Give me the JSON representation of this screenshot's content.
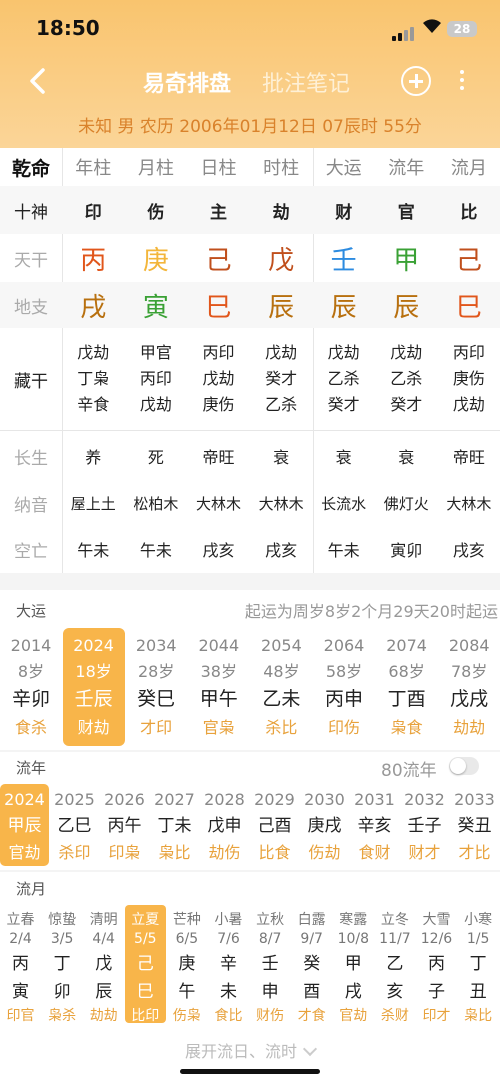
{
  "status": {
    "time": "18:50",
    "battery": "28"
  },
  "nav": {
    "title": "易奇排盘",
    "title2": "批注笔记"
  },
  "info": "未知 男 农历 2006年01月12日 07辰时 55分",
  "table": {
    "header": [
      "乾命",
      "年柱",
      "月柱",
      "日柱",
      "时柱",
      "大运",
      "流年",
      "流月"
    ],
    "shishen": {
      "label": "十神",
      "values": [
        "印",
        "伤",
        "主",
        "劫",
        "财",
        "官",
        "比"
      ]
    },
    "tiangan": {
      "label": "天干",
      "values": [
        "丙",
        "庚",
        "己",
        "戊",
        "壬",
        "甲",
        "己"
      ],
      "colors": [
        "#e1561b",
        "#f3b63b",
        "#c04f1c",
        "#c04f1c",
        "#2c8be0",
        "#3aa135",
        "#c04f1c"
      ]
    },
    "dizhi": {
      "label": "地支",
      "values": [
        "戌",
        "寅",
        "巳",
        "辰",
        "辰",
        "辰",
        "巳"
      ],
      "colors": [
        "#b8700f",
        "#3aa135",
        "#e1561b",
        "#b8700f",
        "#b8700f",
        "#b8700f",
        "#e1561b"
      ]
    },
    "canggan": {
      "label": "藏干",
      "values": [
        [
          "戊劫",
          "丁枭",
          "辛食"
        ],
        [
          "甲官",
          "丙印",
          "戊劫"
        ],
        [
          "丙印",
          "戊劫",
          "庚伤"
        ],
        [
          "戊劫",
          "癸才",
          "乙杀"
        ],
        [
          "戊劫",
          "乙杀",
          "癸才"
        ],
        [
          "戊劫",
          "乙杀",
          "癸才"
        ],
        [
          "丙印",
          "庚伤",
          "戊劫"
        ]
      ]
    },
    "changsheng": {
      "label": "长生",
      "values": [
        "养",
        "死",
        "帝旺",
        "衰",
        "衰",
        "衰",
        "帝旺"
      ]
    },
    "nayin": {
      "label": "纳音",
      "values": [
        "屋上土",
        "松柏木",
        "大林木",
        "大林木",
        "长流水",
        "佛灯火",
        "大林木"
      ]
    },
    "kongwang": {
      "label": "空亡",
      "values": [
        "午未",
        "午未",
        "戌亥",
        "戌亥",
        "午未",
        "寅卯",
        "戌亥"
      ]
    }
  },
  "dayun": {
    "title": "大运",
    "note": "起运为周岁8岁2个月29天20时起运",
    "items": [
      {
        "year": "2014",
        "age": "8岁",
        "gz": "辛卯",
        "ss": "食杀"
      },
      {
        "year": "2024",
        "age": "18岁",
        "gz": "壬辰",
        "ss": "财劫",
        "active": true
      },
      {
        "year": "2034",
        "age": "28岁",
        "gz": "癸巳",
        "ss": "才印"
      },
      {
        "year": "2044",
        "age": "38岁",
        "gz": "甲午",
        "ss": "官枭"
      },
      {
        "year": "2054",
        "age": "48岁",
        "gz": "乙未",
        "ss": "杀比"
      },
      {
        "year": "2064",
        "age": "58岁",
        "gz": "丙申",
        "ss": "印伤"
      },
      {
        "year": "2074",
        "age": "68岁",
        "gz": "丁酉",
        "ss": "枭食"
      },
      {
        "year": "2084",
        "age": "78岁",
        "gz": "戊戌",
        "ss": "劫劫"
      }
    ]
  },
  "liunian": {
    "title": "流年",
    "toggle_label": "80流年",
    "items": [
      {
        "year": "2024",
        "gz": "甲辰",
        "ss": "官劫",
        "active": true
      },
      {
        "year": "2025",
        "gz": "乙巳",
        "ss": "杀印"
      },
      {
        "year": "2026",
        "gz": "丙午",
        "ss": "印枭"
      },
      {
        "year": "2027",
        "gz": "丁未",
        "ss": "枭比"
      },
      {
        "year": "2028",
        "gz": "戊申",
        "ss": "劫伤"
      },
      {
        "year": "2029",
        "gz": "己酉",
        "ss": "比食"
      },
      {
        "year": "2030",
        "gz": "庚戌",
        "ss": "伤劫"
      },
      {
        "year": "2031",
        "gz": "辛亥",
        "ss": "食财"
      },
      {
        "year": "2032",
        "gz": "壬子",
        "ss": "财才"
      },
      {
        "year": "2033",
        "gz": "癸丑",
        "ss": "才比"
      }
    ]
  },
  "liuyue": {
    "title": "流月",
    "items": [
      {
        "jq": "立春",
        "date": "2/4",
        "g": "丙",
        "z": "寅",
        "ss": "印官"
      },
      {
        "jq": "惊蛰",
        "date": "3/5",
        "g": "丁",
        "z": "卯",
        "ss": "枭杀"
      },
      {
        "jq": "清明",
        "date": "4/4",
        "g": "戊",
        "z": "辰",
        "ss": "劫劫"
      },
      {
        "jq": "立夏",
        "date": "5/5",
        "g": "己",
        "z": "巳",
        "ss": "比印",
        "active": true
      },
      {
        "jq": "芒种",
        "date": "6/5",
        "g": "庚",
        "z": "午",
        "ss": "伤枭"
      },
      {
        "jq": "小暑",
        "date": "7/6",
        "g": "辛",
        "z": "未",
        "ss": "食比"
      },
      {
        "jq": "立秋",
        "date": "8/7",
        "g": "壬",
        "z": "申",
        "ss": "财伤"
      },
      {
        "jq": "白露",
        "date": "9/7",
        "g": "癸",
        "z": "酉",
        "ss": "才食"
      },
      {
        "jq": "寒露",
        "date": "10/8",
        "g": "甲",
        "z": "戌",
        "ss": "官劫"
      },
      {
        "jq": "立冬",
        "date": "11/7",
        "g": "乙",
        "z": "亥",
        "ss": "杀财"
      },
      {
        "jq": "大雪",
        "date": "12/6",
        "g": "丙",
        "z": "子",
        "ss": "印才"
      },
      {
        "jq": "小寒",
        "date": "1/5",
        "g": "丁",
        "z": "丑",
        "ss": "枭比"
      }
    ]
  },
  "expand_label": "展开流日、流时",
  "colors": {
    "accent": "#f7b54a",
    "ss": "#e8a23c",
    "muted": "#999"
  }
}
